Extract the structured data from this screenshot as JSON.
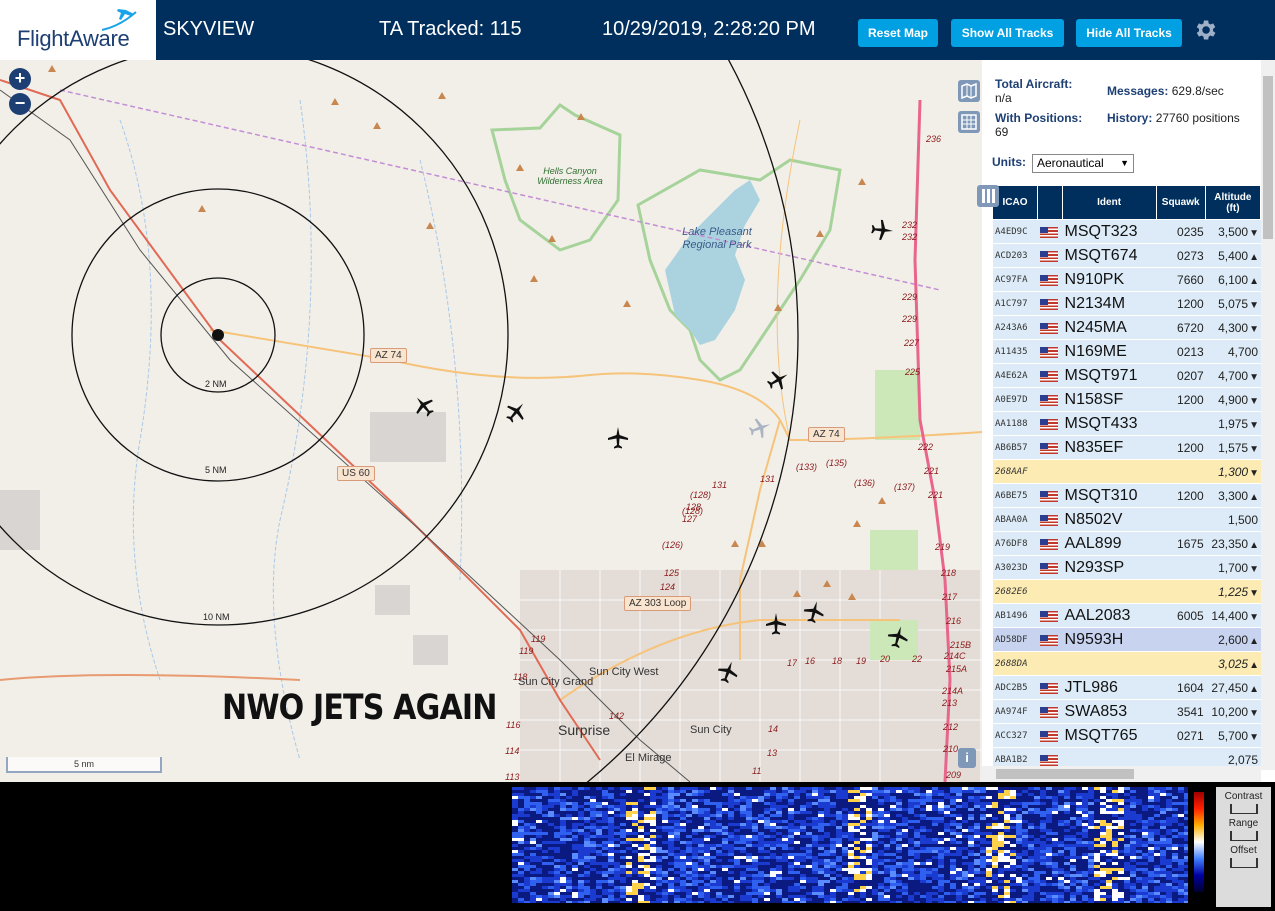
{
  "header": {
    "logo_text": "FlightAware",
    "app_title": "SKYVIEW",
    "tracked": "TA Tracked: 115",
    "datetime": "10/29/2019, 2:28:20 PM",
    "btn_reset": "Reset Map",
    "btn_show": "Show All Tracks",
    "btn_hide": "Hide All Tracks",
    "settings_icon": "gear-icon"
  },
  "map": {
    "zoom_in": "+",
    "zoom_out": "−",
    "scale": "5 nm",
    "overlay_text": "NWO JETS AGAIN",
    "info_btn": "i",
    "rings": [
      "2 NM",
      "5 NM",
      "10 NM"
    ],
    "roads": [
      "AZ 74",
      "AZ 74",
      "US 60",
      "AZ 303 Loop"
    ],
    "towns": [
      "Sun City Grand",
      "Sun City West",
      "Surprise",
      "Sun City",
      "El Mirage"
    ],
    "lake": "Lake Pleasant Regional Park",
    "wilderness": "Hells Canyon Wilderness Area",
    "route_numbers": [
      "236",
      "232",
      "232",
      "229",
      "229",
      "227",
      "225",
      "222",
      "221",
      "221",
      "219",
      "218",
      "217",
      "216",
      "215B",
      "214C",
      "215A",
      "214A",
      "213",
      "212",
      "210",
      "209",
      "131",
      "131",
      "(128)",
      "128",
      "(128)",
      "127",
      "(126)",
      "125",
      "124",
      "(133)",
      "(135)",
      "(136)",
      "(137)",
      "119",
      "119",
      "118",
      "116",
      "114",
      "113",
      "142",
      "14",
      "13",
      "11",
      "17",
      "16",
      "18",
      "19",
      "20",
      "22"
    ]
  },
  "stats": {
    "total_label": "Total Aircraft:",
    "total_value": "n/a",
    "positions_label": "With Positions:",
    "positions_value": "69",
    "messages_label": "Messages:",
    "messages_value": "629.8/sec",
    "history_label": "History:",
    "history_value": "27760 positions",
    "units_label": "Units:",
    "units_value": "Aeronautical"
  },
  "table": {
    "headers": [
      "ICAO",
      "",
      "Ident",
      "Squawk",
      "Altitude (ft)"
    ],
    "rows": [
      {
        "icao": "A4ED9C",
        "flag": true,
        "ident": "MSQT323",
        "squawk": "0235",
        "alt": "3,500",
        "trend": "▼",
        "style": ""
      },
      {
        "icao": "ACD203",
        "flag": true,
        "ident": "MSQT674",
        "squawk": "0273",
        "alt": "5,400",
        "trend": "▲",
        "style": ""
      },
      {
        "icao": "AC97FA",
        "flag": true,
        "ident": "N910PK",
        "squawk": "7660",
        "alt": "6,100",
        "trend": "▲",
        "style": ""
      },
      {
        "icao": "A1C797",
        "flag": true,
        "ident": "N2134M",
        "squawk": "1200",
        "alt": "5,075",
        "trend": "▼",
        "style": ""
      },
      {
        "icao": "A243A6",
        "flag": true,
        "ident": "N245MA",
        "squawk": "6720",
        "alt": "4,300",
        "trend": "▼",
        "style": ""
      },
      {
        "icao": "A11435",
        "flag": true,
        "ident": "N169ME",
        "squawk": "0213",
        "alt": "4,700",
        "trend": "",
        "style": ""
      },
      {
        "icao": "A4E62A",
        "flag": true,
        "ident": "MSQT971",
        "squawk": "0207",
        "alt": "4,700",
        "trend": "▼",
        "style": ""
      },
      {
        "icao": "A0E97D",
        "flag": true,
        "ident": "N158SF",
        "squawk": "1200",
        "alt": "4,900",
        "trend": "▼",
        "style": ""
      },
      {
        "icao": "AA1188",
        "flag": true,
        "ident": "MSQT433",
        "squawk": "",
        "alt": "1,975",
        "trend": "▼",
        "style": ""
      },
      {
        "icao": "AB6B57",
        "flag": true,
        "ident": "N835EF",
        "squawk": "1200",
        "alt": "1,575",
        "trend": "▼",
        "style": ""
      },
      {
        "icao": "268AAF",
        "flag": false,
        "ident": "",
        "squawk": "",
        "alt": "1,300",
        "trend": "▼",
        "style": "noflag"
      },
      {
        "icao": "A6BE75",
        "flag": true,
        "ident": "MSQT310",
        "squawk": "1200",
        "alt": "3,300",
        "trend": "▲",
        "style": ""
      },
      {
        "icao": "ABAA0A",
        "flag": true,
        "ident": "N8502V",
        "squawk": "",
        "alt": "1,500",
        "trend": "",
        "style": ""
      },
      {
        "icao": "A76DF8",
        "flag": true,
        "ident": "AAL899",
        "squawk": "1675",
        "alt": "23,350",
        "trend": "▲",
        "style": ""
      },
      {
        "icao": "A3023D",
        "flag": true,
        "ident": "N293SP",
        "squawk": "",
        "alt": "1,700",
        "trend": "▼",
        "style": ""
      },
      {
        "icao": "2682E6",
        "flag": false,
        "ident": "",
        "squawk": "",
        "alt": "1,225",
        "trend": "▼",
        "style": "noflag"
      },
      {
        "icao": "AB1496",
        "flag": true,
        "ident": "AAL2083",
        "squawk": "6005",
        "alt": "14,400",
        "trend": "▼",
        "style": ""
      },
      {
        "icao": "AD58DF",
        "flag": true,
        "ident": "N9593H",
        "squawk": "",
        "alt": "2,600",
        "trend": "▲",
        "style": "sel"
      },
      {
        "icao": "2688DA",
        "flag": false,
        "ident": "",
        "squawk": "",
        "alt": "3,025",
        "trend": "▲",
        "style": "noflag"
      },
      {
        "icao": "ADC2B5",
        "flag": true,
        "ident": "JTL986",
        "squawk": "1604",
        "alt": "27,450",
        "trend": "▲",
        "style": ""
      },
      {
        "icao": "AA974F",
        "flag": true,
        "ident": "SWA853",
        "squawk": "3541",
        "alt": "10,200",
        "trend": "▼",
        "style": ""
      },
      {
        "icao": "ACC327",
        "flag": true,
        "ident": "MSQT765",
        "squawk": "0271",
        "alt": "5,700",
        "trend": "▼",
        "style": ""
      },
      {
        "icao": "ABA1B2",
        "flag": true,
        "ident": "",
        "squawk": "",
        "alt": "2,075",
        "trend": "",
        "style": ""
      }
    ]
  },
  "spectrum": {
    "contrast": "Contrast",
    "range": "Range",
    "offset": "Offset"
  },
  "colors": {
    "header_bg": "#002F5D",
    "button_bg": "#00a0e2",
    "row_bg": "#dcebf7",
    "row_noflag": "#fcecb4",
    "row_selected": "#c7d3ef"
  }
}
